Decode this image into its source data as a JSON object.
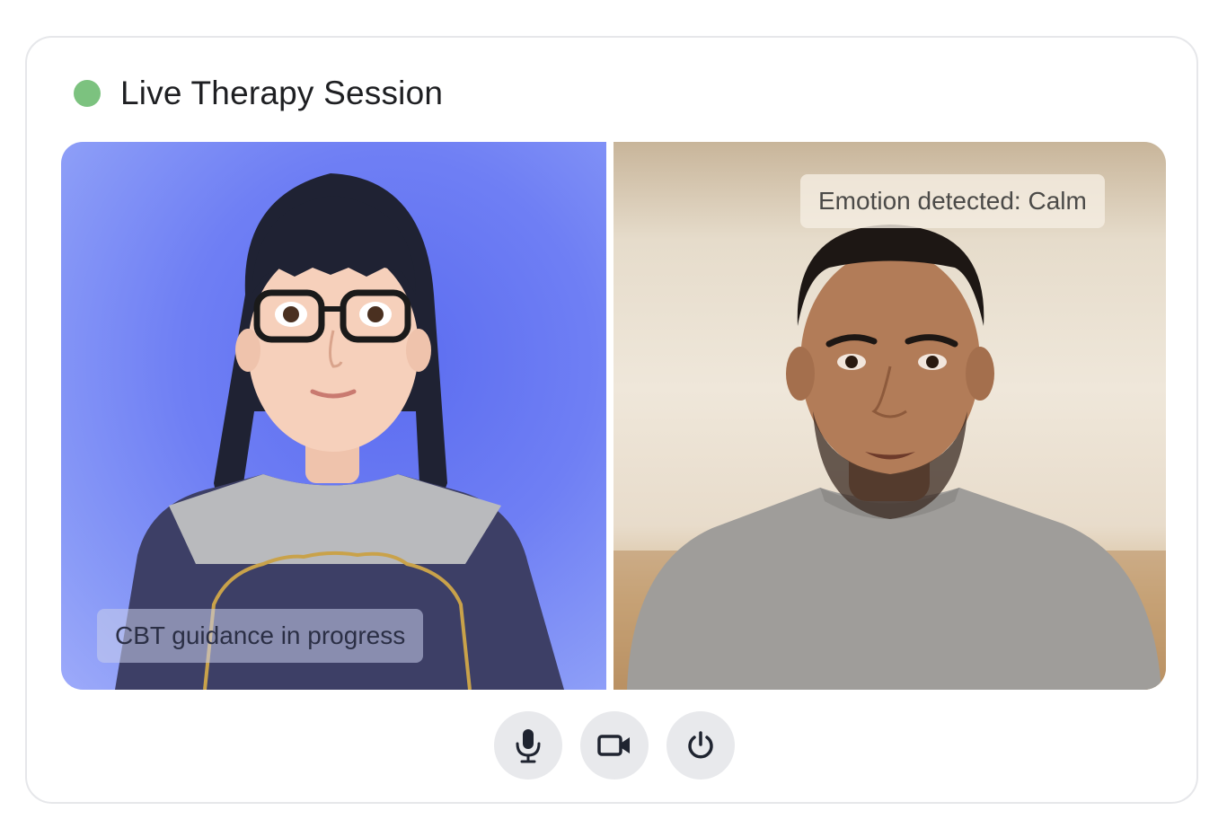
{
  "session": {
    "title": "Live Therapy Session",
    "status_color": "#7cc27f"
  },
  "left_pane": {
    "label": "CBT guidance in progress",
    "background_color": "#5b6cf0"
  },
  "right_pane": {
    "label": "Emotion detected: Calm"
  },
  "controls": [
    {
      "name": "microphone",
      "icon": "microphone-icon"
    },
    {
      "name": "camera",
      "icon": "video-camera-icon"
    },
    {
      "name": "power",
      "icon": "power-icon"
    }
  ]
}
